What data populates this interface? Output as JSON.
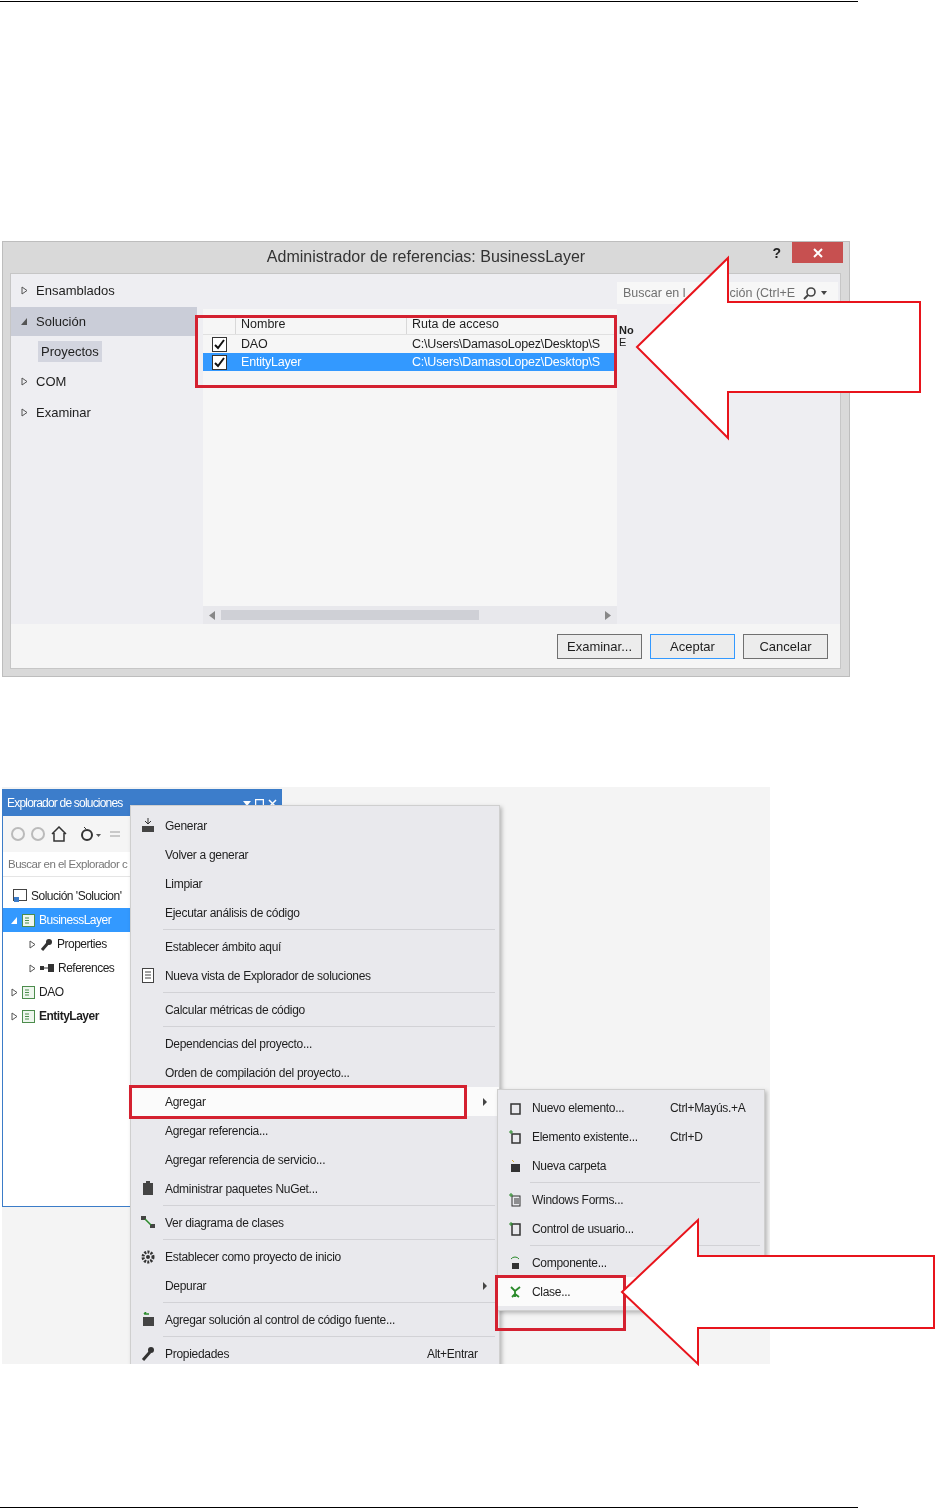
{
  "dialog": {
    "title": "Administrador de referencias: BusinessLayer",
    "help": "?",
    "nav": [
      {
        "label": "Ensamblados",
        "expanded": false,
        "selected": false
      },
      {
        "label": "Solución",
        "expanded": true,
        "selected": true,
        "children": [
          {
            "label": "Proyectos",
            "selected": true
          }
        ]
      },
      {
        "label": "COM",
        "expanded": false,
        "selected": false
      },
      {
        "label": "Examinar",
        "expanded": false,
        "selected": false
      }
    ],
    "search": {
      "placeholder_start": "Buscar en l",
      "placeholder_end": "ción (Ctrl+E"
    },
    "table": {
      "columns": [
        "Nombre",
        "Ruta de acceso"
      ],
      "rows": [
        {
          "name": "DAO",
          "path": "C:\\Users\\DamasoLopez\\Desktop\\S",
          "checked": true,
          "selected": false
        },
        {
          "name": "EntityLayer",
          "path": "C:\\Users\\DamasoLopez\\Desktop\\S",
          "checked": true,
          "selected": true
        }
      ]
    },
    "details": [
      "No",
      "E"
    ],
    "buttons": [
      {
        "label": "Examinar...",
        "default": false
      },
      {
        "label": "Aceptar",
        "default": true
      },
      {
        "label": "Cancelar",
        "default": false
      }
    ]
  },
  "explorer": {
    "title": "Explorador de soluciones",
    "search": {
      "placeholder": "Buscar en el Explorador c"
    },
    "tree": [
      {
        "label": "Solución 'Solucion'",
        "kind": "solution",
        "selected": false,
        "startup": false,
        "children": [
          {
            "label": "BusinessLayer",
            "kind": "project",
            "expanded": true,
            "selected": true,
            "startup": false,
            "children": [
              {
                "label": "Properties",
                "kind": "properties",
                "expanded": false,
                "selected": false,
                "startup": false
              },
              {
                "label": "References",
                "kind": "references",
                "expanded": false,
                "selected": false,
                "startup": false
              }
            ]
          },
          {
            "label": "DAO",
            "kind": "project",
            "expanded": false,
            "selected": false,
            "startup": false
          },
          {
            "label": "EntityLayer",
            "kind": "project",
            "expanded": false,
            "selected": false,
            "startup": true
          }
        ]
      }
    ]
  },
  "context_menu": {
    "items": [
      {
        "label": "Generar",
        "separator_before": false,
        "submenu": false,
        "selected": false
      },
      {
        "label": "Volver a generar",
        "separator_before": false,
        "submenu": false,
        "selected": false
      },
      {
        "label": "Limpiar",
        "separator_before": false,
        "submenu": false,
        "selected": false
      },
      {
        "label": "Ejecutar análisis de código",
        "separator_before": false,
        "submenu": false,
        "selected": false
      },
      {
        "label": "Establecer ámbito aquí",
        "separator_before": true,
        "submenu": false,
        "selected": false
      },
      {
        "label": "Nueva vista de Explorador de soluciones",
        "separator_before": false,
        "submenu": false,
        "selected": false
      },
      {
        "label": "Calcular métricas de código",
        "separator_before": true,
        "submenu": false,
        "selected": false
      },
      {
        "label": "Dependencias del proyecto...",
        "separator_before": true,
        "submenu": false,
        "selected": false
      },
      {
        "label": "Orden de compilación del proyecto...",
        "separator_before": false,
        "submenu": false,
        "selected": false
      },
      {
        "label": "Agregar",
        "separator_before": false,
        "submenu": true,
        "selected": true
      },
      {
        "label": "Agregar referencia...",
        "separator_before": false,
        "submenu": false,
        "selected": false
      },
      {
        "label": "Agregar referencia de servicio...",
        "separator_before": false,
        "submenu": false,
        "selected": false
      },
      {
        "label": "Administrar paquetes NuGet...",
        "separator_before": false,
        "submenu": false,
        "selected": false
      },
      {
        "label": "Ver diagrama de clases",
        "separator_before": true,
        "submenu": false,
        "selected": false
      },
      {
        "label": "Establecer como proyecto de inicio",
        "separator_before": true,
        "submenu": false,
        "selected": false
      },
      {
        "label": "Depurar",
        "separator_before": false,
        "submenu": true,
        "selected": false
      },
      {
        "label": "Agregar solución al control de código fuente...",
        "separator_before": true,
        "submenu": false,
        "selected": false
      },
      {
        "label": "Propiedades",
        "shortcut": "Alt+Entrar",
        "separator_before": true,
        "submenu": false,
        "selected": false
      }
    ]
  },
  "submenu": {
    "items": [
      {
        "label": "Nuevo elemento...",
        "shortcut": "Ctrl+Mayús.+A",
        "separator_before": false,
        "selected": false
      },
      {
        "label": "Elemento existente...",
        "shortcut": "Ctrl+D",
        "separator_before": false,
        "selected": false
      },
      {
        "label": "Nueva carpeta",
        "separator_before": false,
        "selected": false
      },
      {
        "label": "Windows Forms...",
        "separator_before": true,
        "selected": false
      },
      {
        "label": "Control de usuario...",
        "separator_before": false,
        "selected": false
      },
      {
        "label": "Componente...",
        "separator_before": true,
        "selected": false
      },
      {
        "label": "Clase...",
        "separator_before": false,
        "selected": true
      }
    ]
  }
}
